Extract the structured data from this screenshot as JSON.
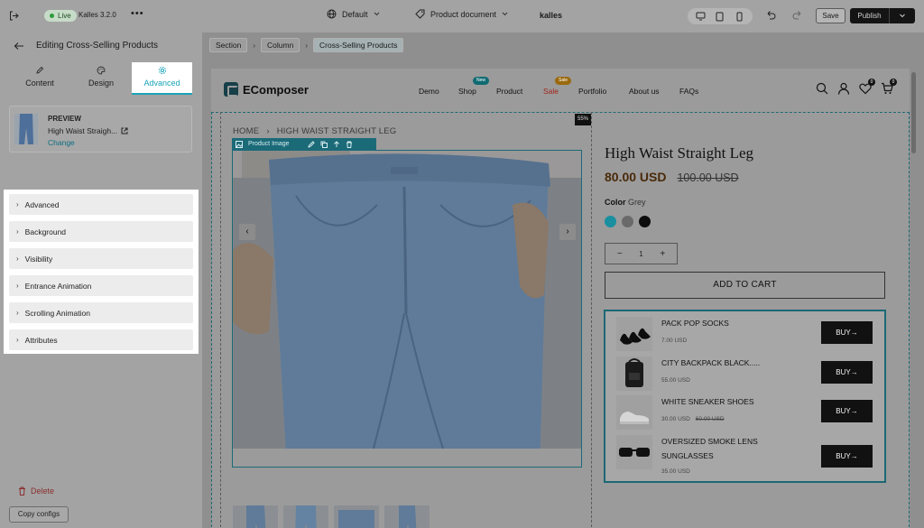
{
  "topbar": {
    "live_label": "Live",
    "version": "Kalles 3.2.0",
    "more": "•••",
    "layout_label": "Default",
    "doc_label": "Product document",
    "store_label": "kalles",
    "save_label": "Save",
    "publish_label": "Publish"
  },
  "sidebar": {
    "title": "Editing Cross-Selling Products",
    "tabs": [
      {
        "label": "Content",
        "icon": "pencil-icon"
      },
      {
        "label": "Design",
        "icon": "palette-icon"
      },
      {
        "label": "Advanced",
        "icon": "gear-icon",
        "active": true
      }
    ],
    "preview": {
      "label": "PREVIEW",
      "product_name": "High Waist Straigh...",
      "change_label": "Change"
    },
    "sections": [
      {
        "label": "Advanced"
      },
      {
        "label": "Background"
      },
      {
        "label": "Visibility"
      },
      {
        "label": "Entrance Animation"
      },
      {
        "label": "Scrolling Animation"
      },
      {
        "label": "Attributes"
      }
    ],
    "delete_label": "Delete",
    "copy_label": "Copy configs"
  },
  "breadcrumb": {
    "items": [
      "Section",
      "Column",
      "Cross-Selling Products"
    ]
  },
  "store": {
    "logo_text": "EComposer",
    "nav": [
      {
        "label": "Demo"
      },
      {
        "label": "Shop",
        "badge": "New"
      },
      {
        "label": "Product"
      },
      {
        "label": "Sale",
        "badge": "Sale"
      },
      {
        "label": "Portfolio"
      },
      {
        "label": "About us"
      },
      {
        "label": "FAQs"
      }
    ],
    "wishlist_count": "0",
    "cart_count": "0"
  },
  "product": {
    "bc_home": "HOME",
    "bc_current": "HIGH WAIST STRAIGHT LEG",
    "width_badge": "55%",
    "image_toolbar_label": "Product Image",
    "title": "High Waist Straight Leg",
    "price": "80.00 USD",
    "compare_price": "100.00 USD",
    "color_label": "Color",
    "color_value": "Grey",
    "swatches": [
      "#1a8fa0",
      "#6a6a6a",
      "#0d0d0d"
    ],
    "qty_minus": "−",
    "qty_value": "1",
    "qty_plus": "+",
    "add_to_cart": "ADD TO CART"
  },
  "cross_sell": {
    "items": [
      {
        "name": "PACK POP SOCKS",
        "price": "7.00 USD",
        "compare": "",
        "buy": "BUY→"
      },
      {
        "name": "CITY BACKPACK BLACK.....",
        "price": "55.00 USD",
        "compare": "",
        "buy": "BUY→"
      },
      {
        "name": "WHITE SNEAKER SHOES",
        "price": "30.00 USD",
        "compare": "60.00 USD",
        "buy": "BUY→"
      },
      {
        "name": "OVERSIZED SMOKE LENS SUNGLASSES",
        "price": "35.00 USD",
        "compare": "",
        "buy": "BUY→"
      }
    ]
  }
}
